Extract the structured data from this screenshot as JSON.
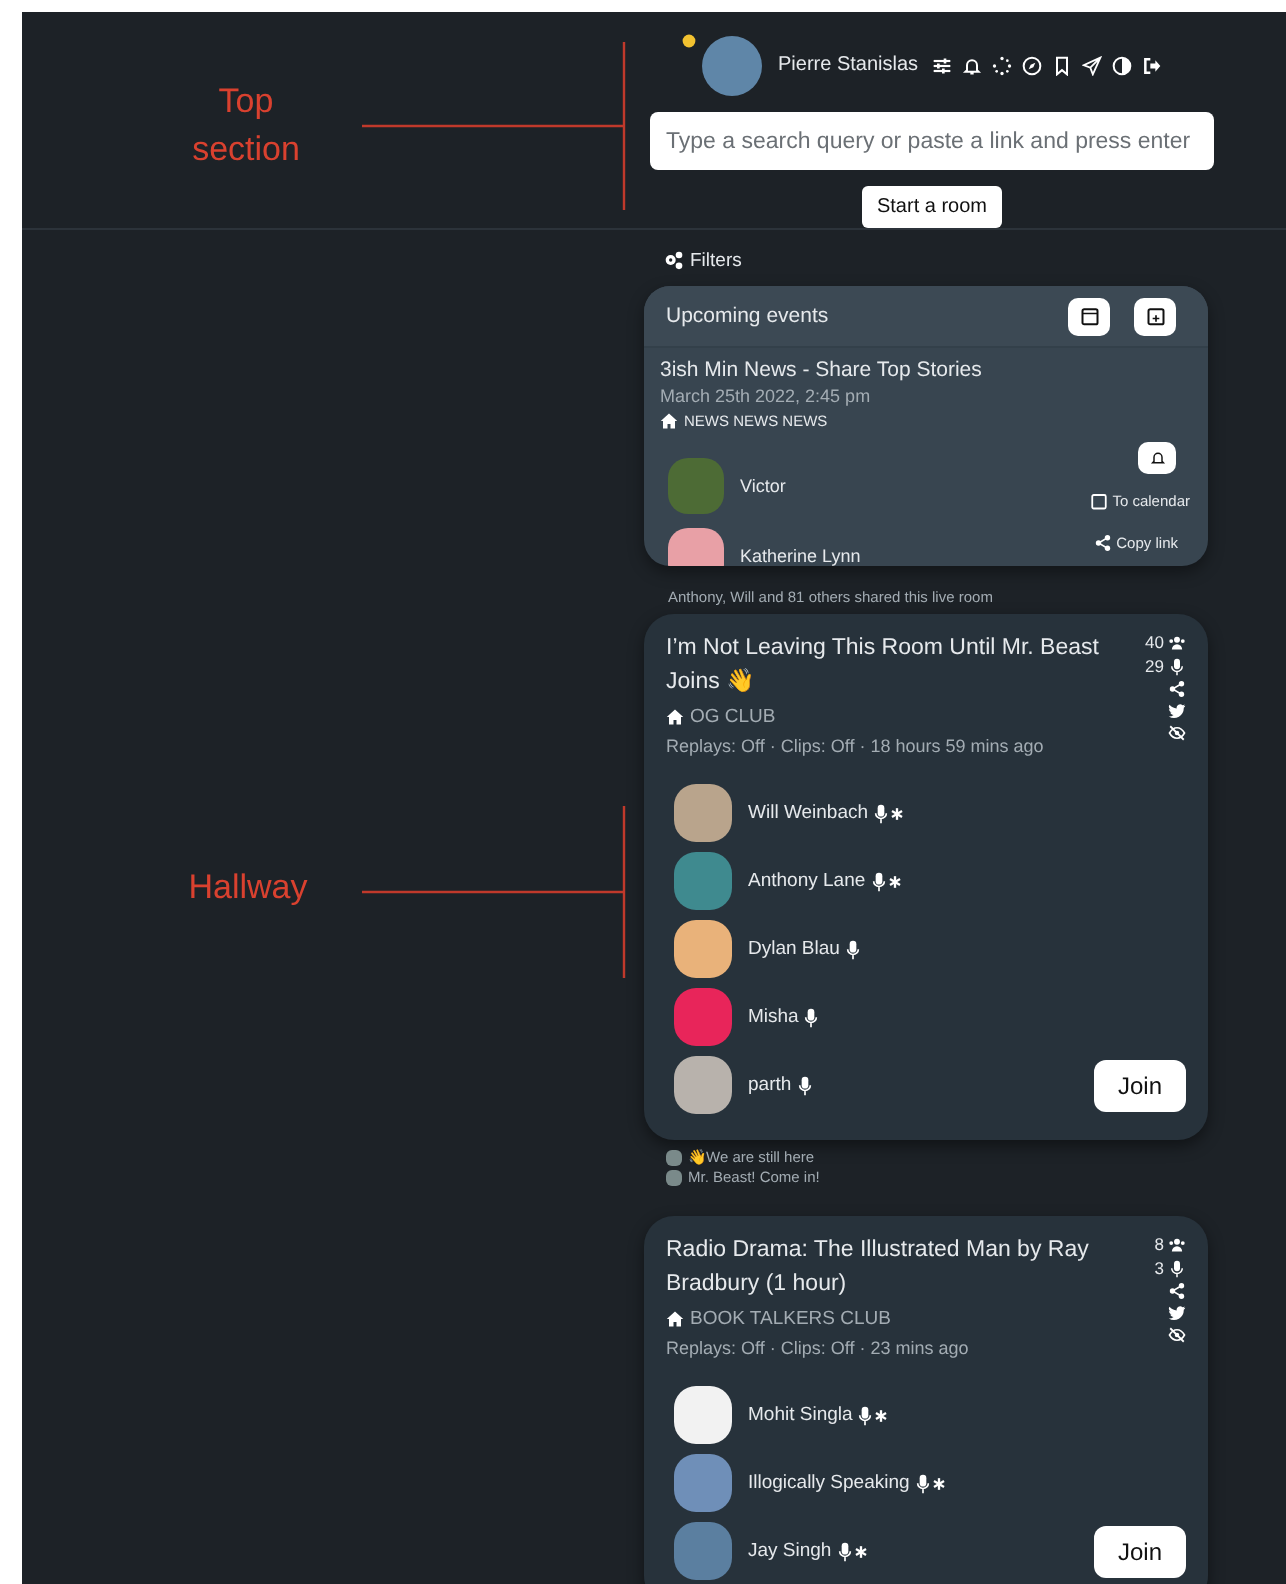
{
  "annotations": [
    {
      "label": "Top section"
    },
    {
      "label": "Hallway"
    }
  ],
  "top": {
    "user": "Pierre Stanislas",
    "search": {
      "placeholder": "Type a search query or paste a link and press enter"
    },
    "start_button": "Start a room"
  },
  "filters": "Filters",
  "upcoming": {
    "title": "Upcoming events",
    "event": {
      "title": "3ish Min News - Share Top Stories",
      "date": "March 25th 2022, 2:45 pm",
      "club": "NEWS NEWS NEWS",
      "speakers": [
        {
          "name": "Victor",
          "color": "#4d6b35"
        },
        {
          "name": "Katherine Lynn",
          "color": "#e8a0a6"
        }
      ],
      "to_calendar": "To calendar",
      "copy_link": "Copy link"
    }
  },
  "rooms": [
    {
      "shared_by": "Anthony, Will and 81 others shared this live room",
      "title": "I’m Not Leaving This Room Until Mr. Beast Joins 👋",
      "club": "OG CLUB",
      "meta": "Replays: Off · Clips: Off · 18 hours 59 mins ago",
      "listeners": "40",
      "speakers_count": "29",
      "join": "Join",
      "people": [
        {
          "name": "Will Weinbach",
          "moderator": true,
          "color": "#b9a48c"
        },
        {
          "name": "Anthony Lane",
          "moderator": true,
          "color": "#3f8a8f"
        },
        {
          "name": "Dylan Blau",
          "moderator": false,
          "color": "#e9b27a"
        },
        {
          "name": "Misha",
          "moderator": false,
          "color": "#e8255a"
        },
        {
          "name": "parth",
          "moderator": false,
          "color": "#b8b2ac"
        }
      ],
      "chat": [
        "👋We are still here",
        "Mr. Beast! Come in!"
      ]
    },
    {
      "title": "Radio Drama: The Illustrated Man by Ray Bradbury (1 hour)",
      "club": "BOOK TALKERS CLUB",
      "meta": "Replays: Off · Clips: Off · 23 mins ago",
      "listeners": "8",
      "speakers_count": "3",
      "join": "Join",
      "people": [
        {
          "name": "Mohit Singla",
          "moderator": true,
          "color": "#f2f2f2"
        },
        {
          "name": "Illogically Speaking",
          "moderator": true,
          "color": "#6f8fb8"
        },
        {
          "name": "Jay Singh",
          "moderator": true,
          "color": "#5b7fa0"
        }
      ]
    }
  ]
}
